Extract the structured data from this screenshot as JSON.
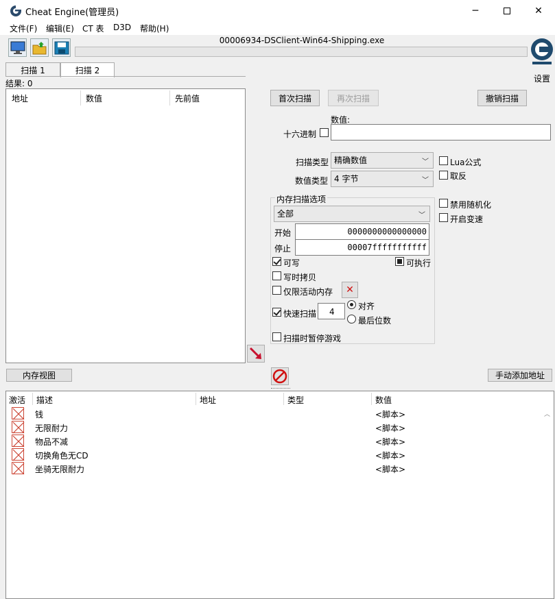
{
  "window": {
    "title": "Cheat Engine(管理员)",
    "process": "00006934-DSClient-Win64-Shipping.exe"
  },
  "menu": [
    "文件(F)",
    "编辑(E)",
    "CT 表",
    "D3D",
    "帮助(H)"
  ],
  "settings_label": "设置",
  "tabs": [
    "扫描 1",
    "扫描 2"
  ],
  "result_count": "结果: 0",
  "result_columns": [
    "地址",
    "数值",
    "先前值"
  ],
  "scan": {
    "first_scan": "首次扫描",
    "next_scan": "再次扫描",
    "undo_scan": "撤销扫描",
    "value_label": "数值:",
    "hex_label": "十六进制",
    "scan_type_label": "扫描类型",
    "scan_type_value": "精确数值",
    "value_type_label": "数值类型",
    "value_type_value": "4 字节",
    "lua_formula": "Lua公式",
    "not_label": "取反",
    "disable_random": "禁用随机化",
    "speedhack": "开启变速"
  },
  "memory_options": {
    "title": "内存扫描选项",
    "region": "全部",
    "start_label": "开始",
    "start_value": "0000000000000000",
    "stop_label": "停止",
    "stop_value": "00007fffffffffff",
    "writable": "可写",
    "executable": "可执行",
    "copy_on_write": "写时拷贝",
    "active_only": "仅限活动内存",
    "fast_scan": "快速扫描",
    "fast_scan_value": "4",
    "align": "对齐",
    "last_digits": "最后位数",
    "pause_game": "扫描时暂停游戏"
  },
  "memory_view": "内存视图",
  "add_address": "手动添加地址",
  "cheat_columns": [
    "激活",
    "描述",
    "地址",
    "类型",
    "数值"
  ],
  "cheat_rows": [
    {
      "desc": "钱",
      "value": "<脚本>"
    },
    {
      "desc": "无限耐力",
      "value": "<脚本>"
    },
    {
      "desc": "物品不减",
      "value": "<脚本>"
    },
    {
      "desc": "切换角色无CD",
      "value": "<脚本>"
    },
    {
      "desc": "坐骑无限耐力",
      "value": "<脚本>"
    }
  ],
  "colors": {
    "accent_red": "#c8102e",
    "title_bg": "#ffffff",
    "window_bg": "#f0f0f0"
  }
}
